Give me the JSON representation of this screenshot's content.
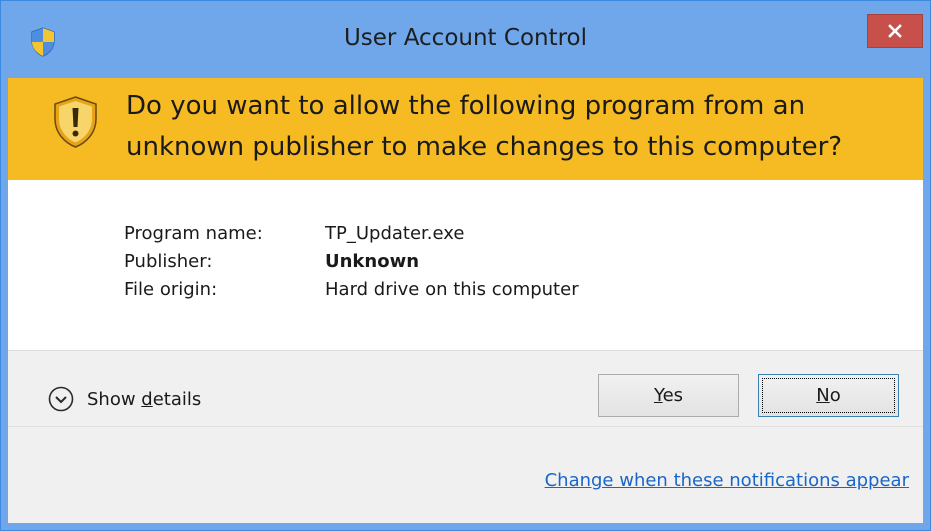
{
  "window": {
    "title": "User Account Control",
    "close_label": "×",
    "accent": "#6fa7ea"
  },
  "header": {
    "message_line1": "Do you want to allow the following program from an",
    "message_line2": "unknown publisher to make changes to this computer?",
    "icon": "shield-warning-icon",
    "background": "#f6bb22"
  },
  "info": {
    "rows": [
      {
        "label": "Program name:",
        "value": "TP_Updater.exe"
      },
      {
        "label": "Publisher:",
        "value": "Unknown"
      },
      {
        "label": "File origin:",
        "value": "Hard drive on this computer"
      }
    ]
  },
  "footer": {
    "details_prefix": "Show ",
    "details_accel": "d",
    "details_suffix": "etails",
    "yes_accel": "Y",
    "yes_rest": "es",
    "no_accel": "N",
    "no_rest": "o",
    "link": "Change when these notifications appear"
  }
}
